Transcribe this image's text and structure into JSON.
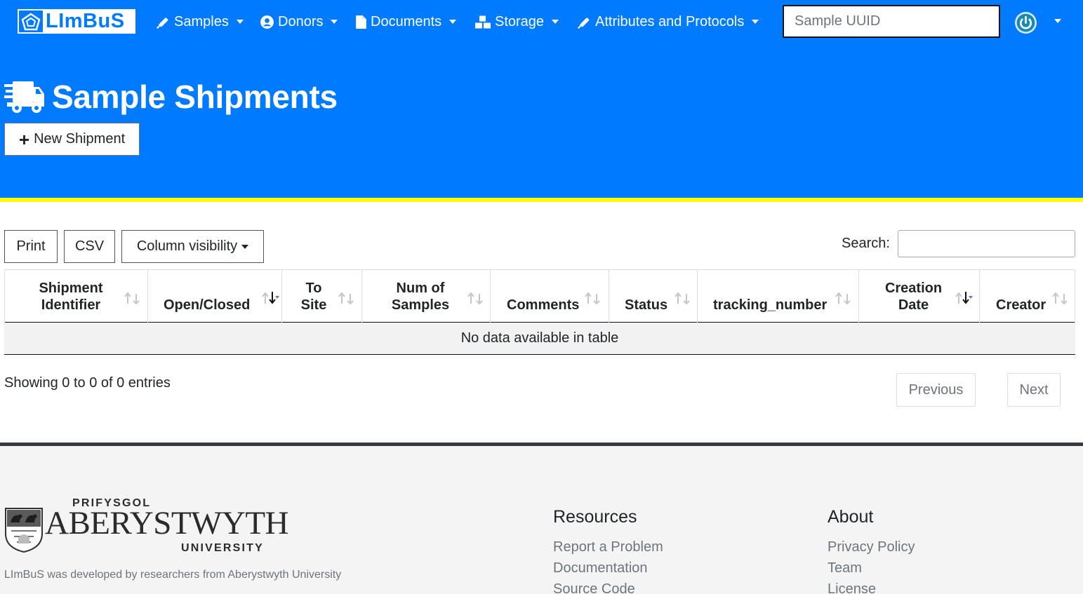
{
  "nav": {
    "brand": "LImBuS",
    "items": [
      {
        "label": "Samples",
        "icon": "syringe-icon"
      },
      {
        "label": "Donors",
        "icon": "user-circle-icon"
      },
      {
        "label": "Documents",
        "icon": "file-icon"
      },
      {
        "label": "Storage",
        "icon": "boxes-icon"
      },
      {
        "label": "Attributes and Protocols",
        "icon": "syringe-icon"
      }
    ],
    "search_placeholder": "Sample UUID",
    "user_icon": "power-icon"
  },
  "page": {
    "title": "Sample Shipments",
    "title_icon": "truck-icon",
    "new_button": "New Shipment"
  },
  "toolbar": {
    "print": "Print",
    "csv": "CSV",
    "column_visibility": "Column visibility",
    "search_label": "Search:"
  },
  "table": {
    "columns": [
      {
        "line1": "Shipment",
        "line2": "Identifier",
        "sort": "none"
      },
      {
        "line1": "",
        "line2": "Open/Closed",
        "sort": "desc"
      },
      {
        "line1": "To",
        "line2": "Site",
        "sort": "none"
      },
      {
        "line1": "Num of",
        "line2": "Samples",
        "sort": "none"
      },
      {
        "line1": "",
        "line2": "Comments",
        "sort": "none"
      },
      {
        "line1": "",
        "line2": "Status",
        "sort": "none"
      },
      {
        "line1": "",
        "line2": "tracking_number",
        "sort": "none"
      },
      {
        "line1": "Creation",
        "line2": "Date",
        "sort": "desc"
      },
      {
        "line1": "",
        "line2": "Creator",
        "sort": "none"
      }
    ],
    "empty_message": "No data available in table",
    "info": "Showing 0 to 0 of 0 entries",
    "previous": "Previous",
    "next": "Next"
  },
  "footer": {
    "university_top": "PRIFYSGOL",
    "university_main": "ABERYSTWYTH",
    "university_bottom": "UNIVERSITY",
    "developed_by": "LImBuS was developed by researchers from Aberystwyth University",
    "resources": {
      "heading": "Resources",
      "links": [
        "Report a Problem",
        "Documentation",
        "Source Code"
      ]
    },
    "about": {
      "heading": "About",
      "links": [
        "Privacy Policy",
        "Team",
        "License"
      ]
    }
  },
  "colors": {
    "primary": "#007bff",
    "stripe": "#ffff00",
    "footer_bg": "#f4f4f4",
    "footer_border": "#343a40",
    "sort_active": "#6a6ae0"
  }
}
